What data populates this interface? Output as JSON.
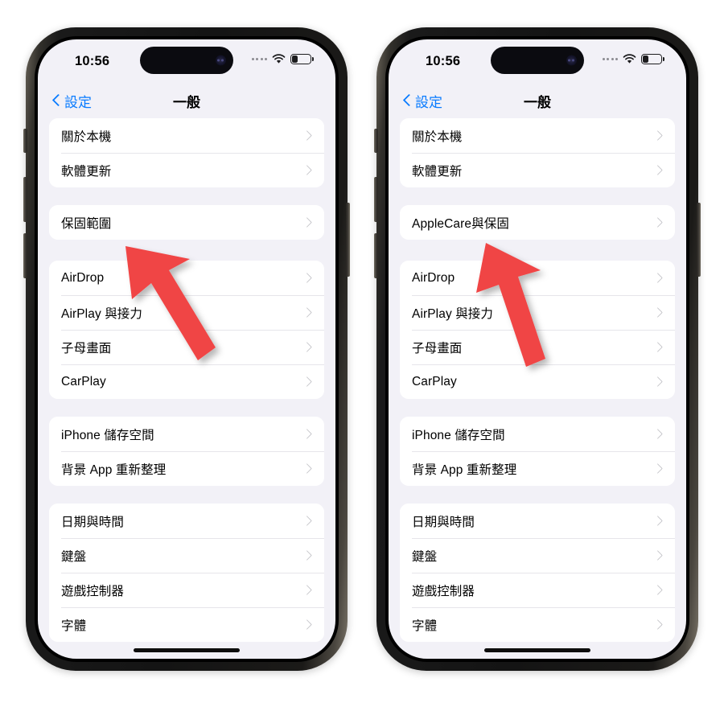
{
  "meta": {
    "platform": "iOS Settings",
    "language": "zh-Hant",
    "accent_color": "#0a7cff",
    "arrow_color": "#f04545",
    "background_color": "#ffffff",
    "screen_background": "#f2f1f7"
  },
  "status_bar": {
    "time": "10:56",
    "cellular_icon": "signal-dots-icon",
    "wifi_icon": "wifi-icon",
    "battery_icon": "battery-low-icon"
  },
  "nav": {
    "back_icon": "chevron-left-icon",
    "back_label": "設定",
    "title": "一般"
  },
  "phones": [
    {
      "id": "left",
      "label": "before-rename",
      "warranty_label": "保固範圍",
      "groups": [
        {
          "rows": [
            {
              "label": "關於本機"
            },
            {
              "label": "軟體更新"
            }
          ]
        },
        {
          "rows": [
            {
              "label": "保固範圍"
            }
          ]
        },
        {
          "rows": [
            {
              "label": "AirDrop"
            },
            {
              "label": "AirPlay 與接力"
            },
            {
              "label": "子母畫面"
            },
            {
              "label": "CarPlay"
            }
          ]
        },
        {
          "rows": [
            {
              "label": "iPhone 儲存空間"
            },
            {
              "label": "背景 App 重新整理"
            }
          ]
        },
        {
          "rows": [
            {
              "label": "日期與時間"
            },
            {
              "label": "鍵盤"
            },
            {
              "label": "遊戲控制器"
            },
            {
              "label": "字體"
            }
          ]
        }
      ]
    },
    {
      "id": "right",
      "label": "after-rename",
      "warranty_label": "AppleCare與保固",
      "groups": [
        {
          "rows": [
            {
              "label": "關於本機"
            },
            {
              "label": "軟體更新"
            }
          ]
        },
        {
          "rows": [
            {
              "label": "AppleCare與保固"
            }
          ]
        },
        {
          "rows": [
            {
              "label": "AirDrop"
            },
            {
              "label": "AirPlay 與接力"
            },
            {
              "label": "子母畫面"
            },
            {
              "label": "CarPlay"
            }
          ]
        },
        {
          "rows": [
            {
              "label": "iPhone 儲存空間"
            },
            {
              "label": "背景 App 重新整理"
            }
          ]
        },
        {
          "rows": [
            {
              "label": "日期與時間"
            },
            {
              "label": "鍵盤"
            },
            {
              "label": "遊戲控制器"
            },
            {
              "label": "字體"
            }
          ]
        }
      ]
    }
  ],
  "annotations": [
    {
      "id": "arrow-left",
      "icon": "up-left-arrow-icon",
      "points_at": "保固範圍"
    },
    {
      "id": "arrow-right",
      "icon": "up-left-arrow-icon",
      "points_at": "AppleCare與保固"
    }
  ]
}
